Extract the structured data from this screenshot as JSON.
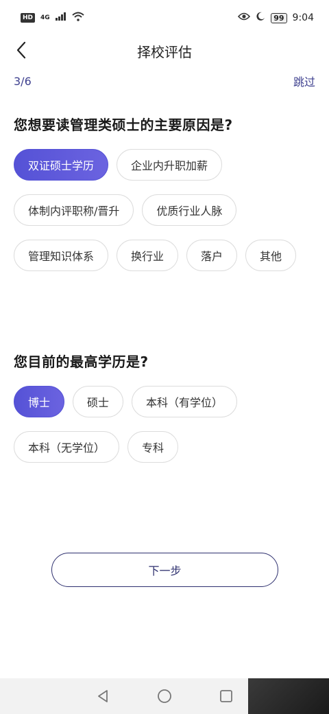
{
  "status_bar": {
    "hd": "HD",
    "signal": "4G",
    "battery": "99",
    "time": "9:04"
  },
  "header": {
    "title": "择校评估"
  },
  "progress": {
    "text": "3/6",
    "skip_label": "跳过"
  },
  "question1": {
    "title": "您想要读管理类硕士的主要原因是?",
    "options": [
      "双证硕士学历",
      "企业内升职加薪",
      "体制内评职称/晋升",
      "优质行业人脉",
      "管理知识体系",
      "换行业",
      "落户",
      "其他"
    ],
    "selected_index": 0
  },
  "question2": {
    "title": "您目前的最高学历是?",
    "options": [
      "博士",
      "硕士",
      "本科（有学位）",
      "本科（无学位）",
      "专科"
    ],
    "selected_index": 0
  },
  "footer": {
    "next_label": "下一步"
  },
  "colors": {
    "accent": "#5552d6",
    "nav_text": "#3d3f8e"
  }
}
